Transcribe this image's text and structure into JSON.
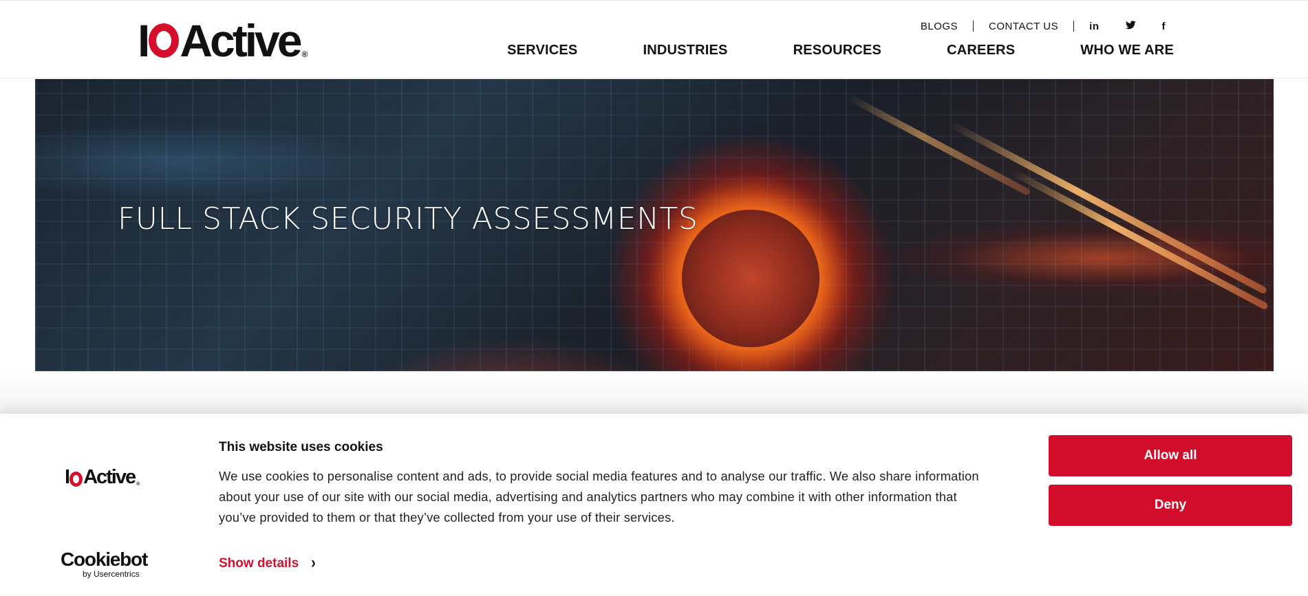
{
  "header": {
    "logo_text_io_i": "I",
    "logo_text_active": "Active",
    "logo_reg": "®",
    "topnav": {
      "blogs": "BLOGS",
      "contact": "CONTACT US"
    },
    "social": {
      "linkedin_glyph": "in",
      "twitter_glyph": "🐦",
      "facebook_glyph": "f"
    },
    "mainnav": [
      "SERVICES",
      "INDUSTRIES",
      "RESOURCES",
      "CAREERS",
      "WHO WE ARE"
    ]
  },
  "hero": {
    "title": "FULL STACK SECURITY ASSESSMENTS"
  },
  "cookie_banner": {
    "logo_io_i": "I",
    "logo_active": "Active",
    "logo_reg": "®",
    "title": "This website uses cookies",
    "text": "We use cookies to personalise content and ads, to provide social media features and to analyse our traffic. We also share information about your use of our site with our social media, advertising and analytics partners who may combine it with other information that you’ve provided to them or that they’ve collected from your use of their services.",
    "show_details": "Show details",
    "chevron": "›",
    "allow_all": "Allow all",
    "deny": "Deny",
    "cookiebot_word": "Cookiebot",
    "cookiebot_sub": "by Usercentrics"
  },
  "colors": {
    "brand_red": "#d10d2c",
    "text_dark": "#111111"
  },
  "icons": [
    "linkedin-icon",
    "twitter-icon",
    "facebook-icon",
    "chevron-right-icon"
  ]
}
